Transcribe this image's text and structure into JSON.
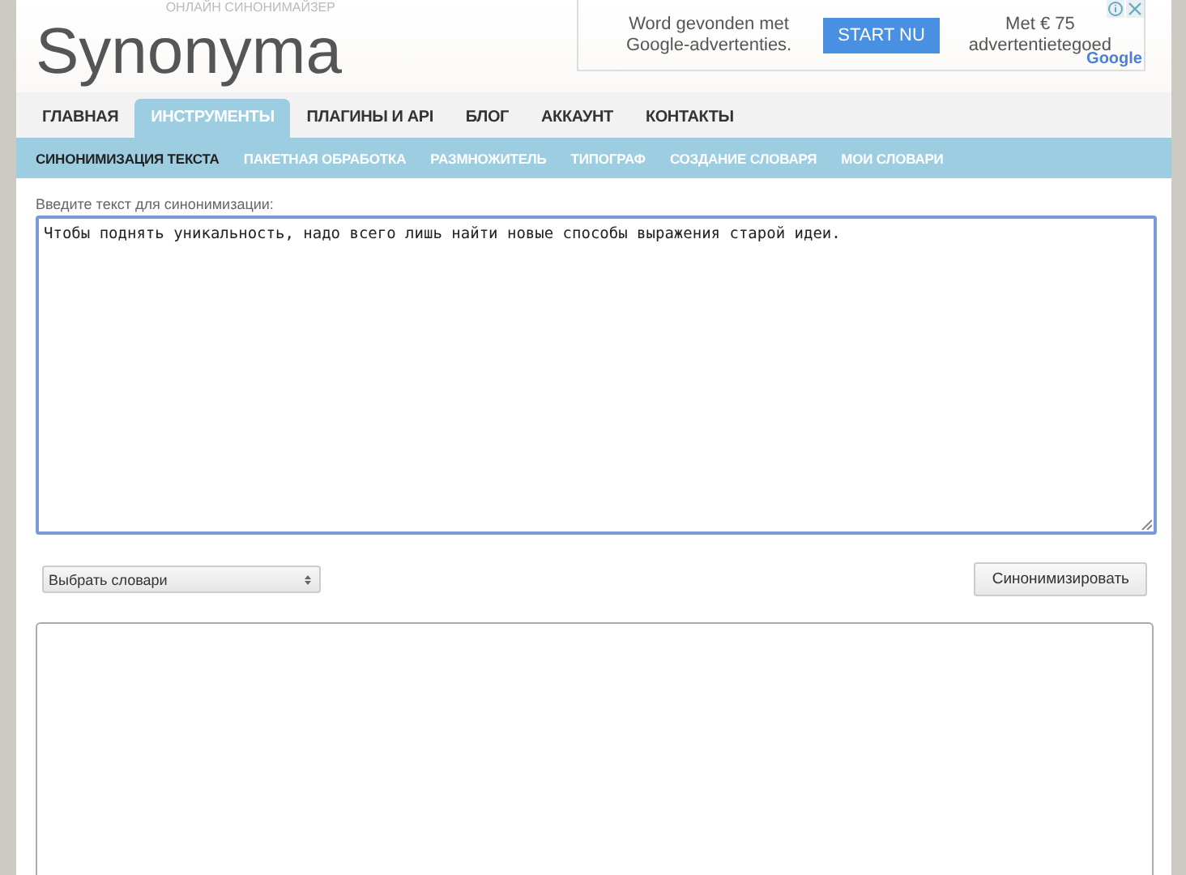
{
  "header": {
    "logo": "Synonyma",
    "tagline": "ОНЛАЙН СИНОНИМАЙЗЕР"
  },
  "ad": {
    "text_left": "Word gevonden met Google-advertenties.",
    "button": "START NU",
    "text_right": "Met € 75 advertentietegoed",
    "brand": "Google"
  },
  "tabs": [
    {
      "label": "ГЛАВНАЯ",
      "selected": false
    },
    {
      "label": "ИНСТРУМЕНТЫ",
      "selected": true
    },
    {
      "label": "ПЛАГИНЫ И API",
      "selected": false
    },
    {
      "label": "БЛОГ",
      "selected": false
    },
    {
      "label": "АККАУНТ",
      "selected": false
    },
    {
      "label": "КОНТАКТЫ",
      "selected": false
    }
  ],
  "subtabs": [
    {
      "label": "СИНОНИМИЗАЦИЯ ТЕКСТА",
      "selected": true
    },
    {
      "label": "ПАКЕТНАЯ ОБРАБОТКА",
      "selected": false
    },
    {
      "label": "РАЗМНОЖИТЕЛЬ",
      "selected": false
    },
    {
      "label": "ТИПОГРАФ",
      "selected": false
    },
    {
      "label": "СОЗДАНИЕ СЛОВАРЯ",
      "selected": false
    },
    {
      "label": "МОИ СЛОВАРИ",
      "selected": false
    }
  ],
  "form": {
    "label": "Введите текст для синонимизации:",
    "input_value": "Чтобы поднять уникальность, надо всего лишь найти новые способы выражения старой идеи.",
    "dictionary_select": "Выбрать словари",
    "submit_button": "Синонимизировать"
  }
}
